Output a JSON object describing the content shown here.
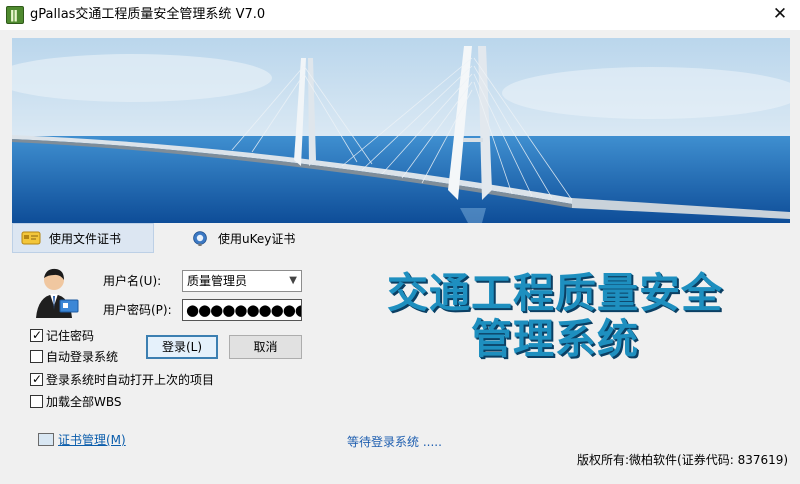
{
  "window": {
    "title": "gPallas交通工程质量安全管理系统 V7.0",
    "close_glyph": "✕"
  },
  "tabs": [
    {
      "label": "使用文件证书",
      "icon": "certificate-card-icon",
      "selected": true
    },
    {
      "label": "使用uKey证书",
      "icon": "ukey-icon",
      "selected": false
    }
  ],
  "login": {
    "username_label": "用户名(U):",
    "username_value": "质量管理员",
    "password_label": "用户密码(P):",
    "password_masked": "●●●●●●●●●●●",
    "remember_password": {
      "label": "记住密码",
      "checked": true
    },
    "auto_login": {
      "label": "自动登录系统",
      "checked": false
    },
    "open_last_project": {
      "label": "登录系统时自动打开上次的项目",
      "checked": true
    },
    "load_all_wbs": {
      "label": "加载全部WBS",
      "checked": false
    },
    "login_button": "登录(L)",
    "cancel_button": "取消"
  },
  "system_title": {
    "line1": "交通工程质量安全",
    "line2": "管理系统"
  },
  "footer": {
    "cert_manage_link": "证书管理(M)",
    "status_text": "等待登录系统 .....",
    "copyright": "版权所有:微柏软件(证券代码: 837619)"
  },
  "colors": {
    "title_text": "#1e8fbf",
    "title_shadow": "#0b3f63",
    "link": "#0b5dab",
    "status": "#1f5fb0",
    "selected_tab": "#dce6f2"
  }
}
